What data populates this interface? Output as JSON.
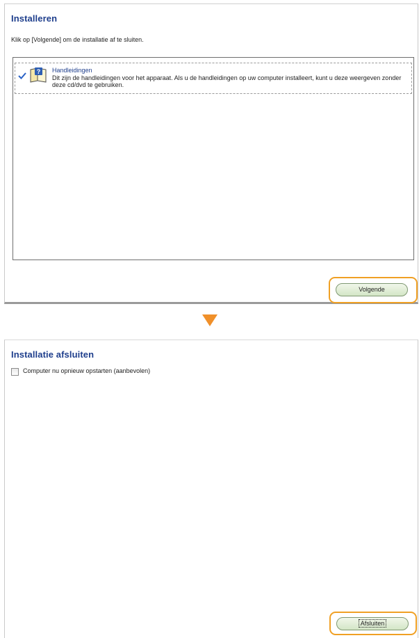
{
  "step1": {
    "title": "Installeren",
    "instruction": "Klik op [Volgende] om de installatie af te sluiten.",
    "item": {
      "checked": true,
      "title": "Handleidingen",
      "description": "Dit zijn de handleidingen voor het apparaat. Als u de handleidingen op uw computer installeert, kunt u deze weergeven zonder deze cd/dvd te gebruiken.",
      "icon": "manual-icon"
    },
    "next_button": "Volgende"
  },
  "transition_arrow": {
    "icon": "arrow-down-icon",
    "color": "#f0902a"
  },
  "step2": {
    "title": "Installatie afsluiten",
    "restart_checkbox": {
      "label": "Computer nu opnieuw opstarten (aanbevolen)",
      "checked": false
    },
    "finish_button": "Afsluiten"
  },
  "colors": {
    "title_blue": "#1e3e8c",
    "highlight_orange": "#f0a024",
    "button_green": "#d3e6c6"
  }
}
